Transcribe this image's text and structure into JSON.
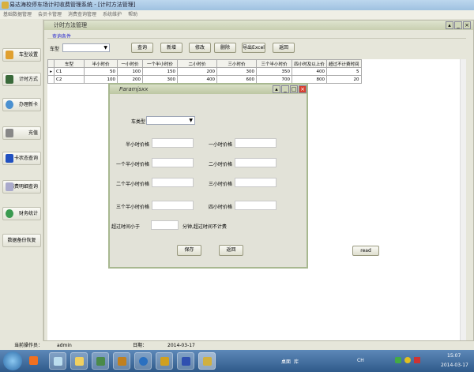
{
  "app": {
    "title": "易达海校停车场计时收费管理系统 - [计时方法管理]"
  },
  "menu": [
    "基础数据管理",
    "会员卡管理",
    "消费查询管理",
    "系统维护",
    "帮助"
  ],
  "sidebar": [
    "车型设置",
    "计时方式",
    "办理新卡",
    "充值",
    "卡状态查询",
    "消费明细查询",
    "财务统计",
    "数据备份恢复"
  ],
  "mdi": {
    "title": "计时方法管理",
    "group": "查询条件",
    "car_type_label": "车型",
    "car_type_value": "",
    "buttons": [
      "查询",
      "新增",
      "修改",
      "删除",
      "导出Excel",
      "返回"
    ]
  },
  "grid": {
    "headers": [
      "车型",
      "半小时价",
      "一小时价",
      "一个半小时价",
      "二小时价",
      "三小时价",
      "三个半小时价",
      "四小时及以上价",
      "超过不计费时间"
    ],
    "rows": [
      [
        "C1",
        "50",
        "100",
        "150",
        "200",
        "300",
        "350",
        "400",
        "5"
      ],
      [
        "C2",
        "100",
        "200",
        "300",
        "400",
        "600",
        "700",
        "800",
        "20"
      ]
    ]
  },
  "dialog": {
    "title": "Paramjsxx",
    "car_type_label": "车类型",
    "car_type_value": "",
    "fields": [
      "半小时价格",
      "一小时价格",
      "一个半小时价格",
      "二小时价格",
      "二个半小时价格",
      "三小时价格",
      "三个半小时价格",
      "四小时价格"
    ],
    "free_label": "超过时间小于",
    "free_suffix": "分钟,超过时间不计费",
    "save": "保存",
    "back": "返回"
  },
  "read_button": "read",
  "status": {
    "operator_label": "当前操作员：",
    "operator": "admin",
    "date_label": "日期：",
    "date": "2014-03-17"
  },
  "tray": {
    "lang": "CH",
    "time": "15:07",
    "date": "2014-03-17",
    "desktop": "桌面",
    "library": "库"
  }
}
